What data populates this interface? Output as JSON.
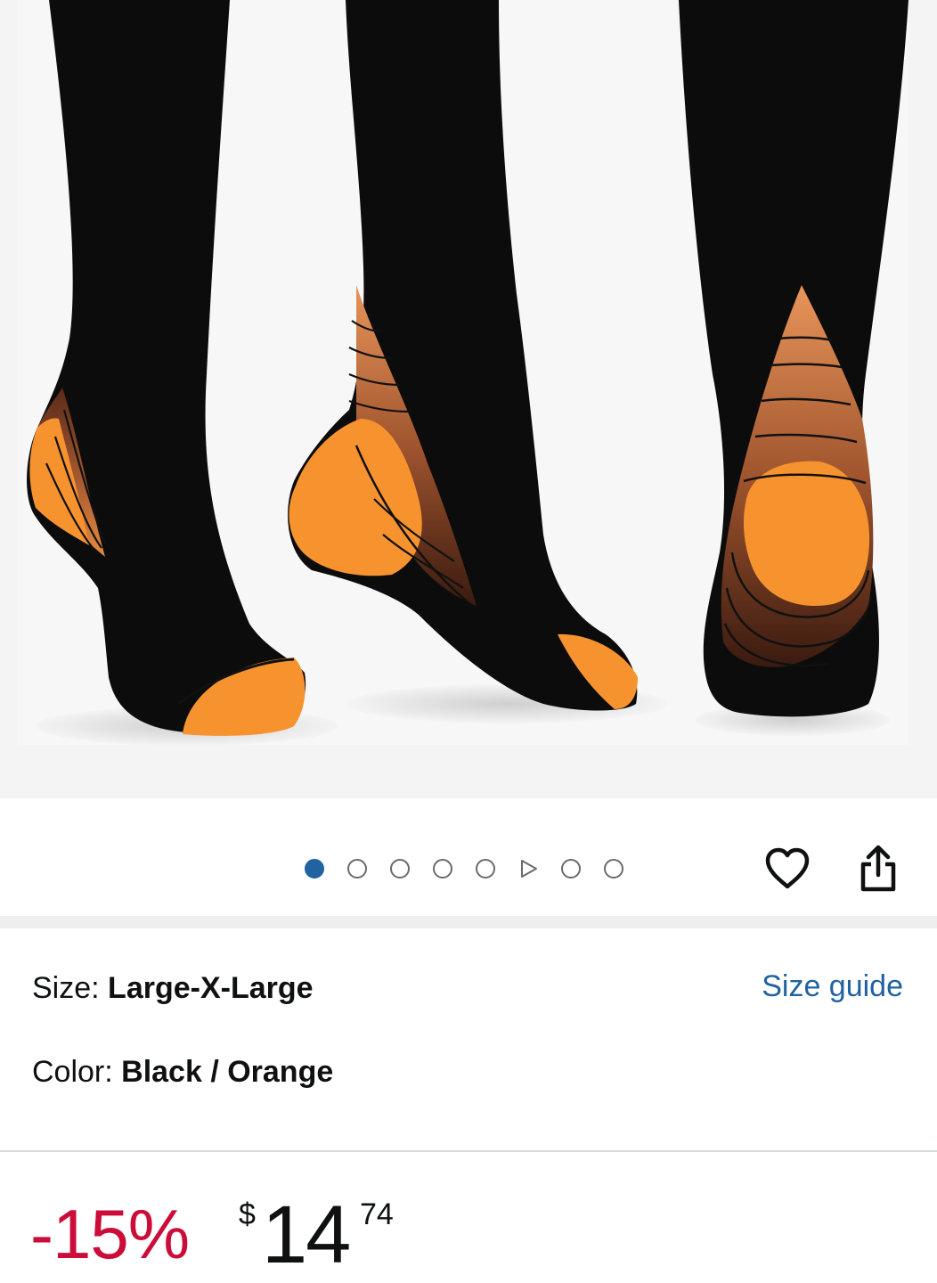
{
  "product_image": {
    "alt": "Black compression socks with orange heel and toe"
  },
  "carousel": {
    "total_slides": 8,
    "active_index": 0,
    "video_slide_index": 5
  },
  "actions": {
    "wishlist_icon": "heart-outline-icon",
    "share_icon": "share-icon"
  },
  "variations": {
    "size_label": "Size: ",
    "size_value": "Large-X-Large",
    "size_guide_link": "Size guide",
    "color_label": "Color: ",
    "color_value": "Black / Orange"
  },
  "price": {
    "discount": "-15%",
    "currency_symbol": "$",
    "whole": "14",
    "fraction": "74"
  },
  "colors": {
    "link": "#2162a1",
    "discount": "#cc0c39",
    "text": "#0f1111",
    "sock_black": "#0c0c0c",
    "sock_orange": "#f7932f"
  }
}
